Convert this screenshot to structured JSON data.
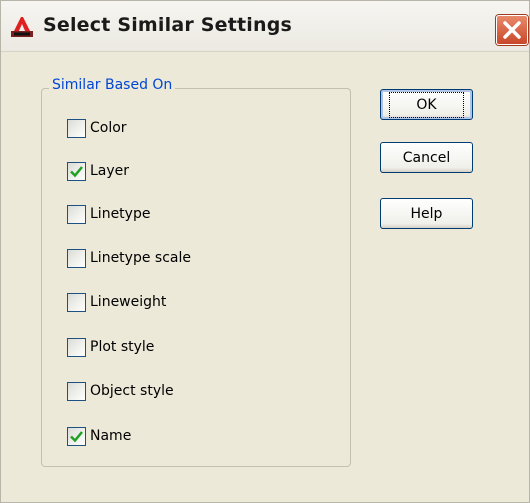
{
  "window": {
    "title": "Select Similar Settings"
  },
  "group": {
    "label": "Similar Based On",
    "options": [
      {
        "label": "Color",
        "checked": false
      },
      {
        "label": "Layer",
        "checked": true
      },
      {
        "label": "Linetype",
        "checked": false
      },
      {
        "label": "Linetype scale",
        "checked": false
      },
      {
        "label": "Lineweight",
        "checked": false
      },
      {
        "label": "Plot style",
        "checked": false
      },
      {
        "label": "Object style",
        "checked": false
      },
      {
        "label": "Name",
        "checked": true
      }
    ]
  },
  "buttons": {
    "ok": "OK",
    "cancel": "Cancel",
    "help": "Help"
  },
  "colors": {
    "accent_text": "#0046d5",
    "checkmark": "#21a121",
    "close": "#c9472a"
  },
  "icons": {
    "app": "autocad-logo-icon",
    "close": "close-icon",
    "check": "checkmark-icon"
  }
}
